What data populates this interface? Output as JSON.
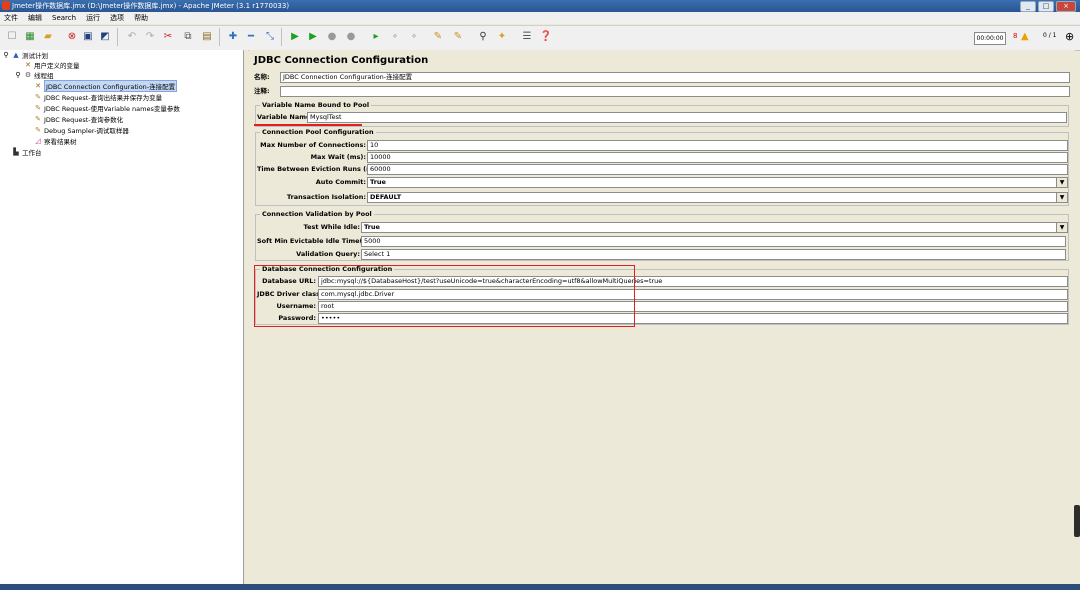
{
  "window": {
    "title": "Jmeter操作数据库.jmx (D:\\Jmeter操作数据库.jmx) - Apache JMeter (3.1 r1770033)",
    "buttons": [
      "_",
      "□",
      "×"
    ]
  },
  "menu": [
    "文件",
    "编辑",
    "Search",
    "运行",
    "选项",
    "帮助"
  ],
  "toolbar": {
    "timer": "00:00:00",
    "error_count": "8",
    "threads": "0 / 1"
  },
  "tree": {
    "test_plan": "测试计划",
    "user_vars": "用户定义的变量",
    "thread_group": "线程组",
    "jdbc_config": "JDBC Connection Configuration-连接配置",
    "req1": "JDBC Request-查询出结果并保存为变量",
    "req2": "JDBC Request-使用Variable names变量参数",
    "req3": "JDBC Request-查询参数化",
    "debug": "Debug Sampler-调试取样器",
    "results": "察看结果树",
    "workbench": "工作台"
  },
  "panel": {
    "heading": "JDBC Connection Configuration",
    "name_label": "名称:",
    "name_value": "JDBC Connection Configuration-连接配置",
    "comment_label": "注释:",
    "comment_value": "",
    "pool_bound": {
      "title": "Variable Name Bound to Pool",
      "var_label": "Variable Name:",
      "var_value": "MysqlTest"
    },
    "pool_config": {
      "title": "Connection Pool Configuration",
      "max_conn_label": "Max Number of Connections:",
      "max_conn_value": "10",
      "max_wait_label": "Max Wait (ms):",
      "max_wait_value": "10000",
      "eviction_label": "Time Between Eviction Runs (ms):",
      "eviction_value": "60000",
      "autocommit_label": "Auto Commit:",
      "autocommit_value": "True",
      "isolation_label": "Transaction Isolation:",
      "isolation_value": "DEFAULT"
    },
    "validation": {
      "title": "Connection Validation by Pool",
      "test_idle_label": "Test While Idle:",
      "test_idle_value": "True",
      "soft_min_label": "Soft Min Evictable Idle Time(ms):",
      "soft_min_value": "5000",
      "query_label": "Validation Query:",
      "query_value": "Select 1"
    },
    "db_config": {
      "title": "Database Connection Configuration",
      "url_label": "Database URL:",
      "url_value": "jdbc:mysql://${DatabaseHost}/test?useUnicode=true&characterEncoding=utf8&allowMultiQueries=true",
      "driver_label": "JDBC Driver class:",
      "driver_value": "com.mysql.jdbc.Driver",
      "user_label": "Username:",
      "user_value": "root",
      "pass_label": "Password:",
      "pass_value": "•••••"
    }
  },
  "colors": {
    "highlight": "#e02020",
    "selection": "#c4d8f5",
    "title_bar": "#2a5592"
  }
}
